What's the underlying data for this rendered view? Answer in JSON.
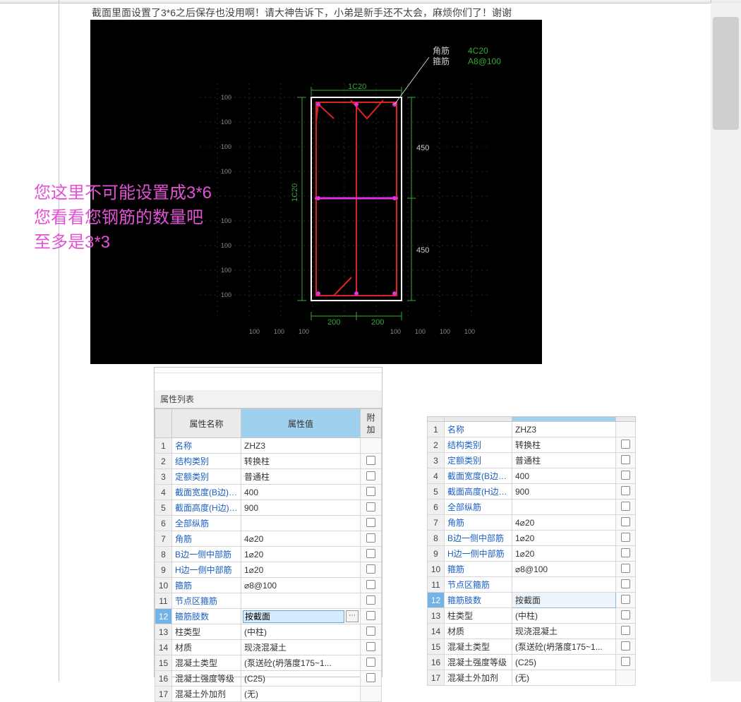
{
  "question_text": "截面里面设置了3*6之后保存也没用啊！请大神告诉下，小弟是新手还不太会，麻烦你们了！谢谢",
  "comment_lines": [
    "您这里不可能设置成3*6",
    "您看看您钢筋的数量吧",
    "至多是3*3"
  ],
  "cad": {
    "label_corner_rebar": "角筋",
    "label_stirrup": "箍筋",
    "val_corner_rebar": "4C20",
    "val_stirrup": "A8@100",
    "top_label": "1C20",
    "left_label": "1C20",
    "dim_right_upper": "450",
    "dim_right_lower": "450",
    "dim_bottom_left": "200",
    "dim_bottom_right": "200",
    "grid_minor": [
      "100",
      "100",
      "100",
      "100",
      "100",
      "100",
      "100"
    ],
    "grid_left_labels": [
      "100",
      "100",
      "100",
      "100",
      "100",
      "100",
      "100"
    ],
    "grid_bottom_labels": [
      "100",
      "100",
      "100",
      "100",
      "100",
      "100",
      "100"
    ]
  },
  "panel_left": {
    "title": "属性列表",
    "headers": {
      "name": "属性名称",
      "value": "属性值",
      "extra": "附加"
    },
    "rows": [
      {
        "n": 1,
        "name": "名称",
        "val": "ZHZ3",
        "chk": false,
        "link": true
      },
      {
        "n": 2,
        "name": "结构类别",
        "val": "转换柱",
        "chk": true,
        "link": true
      },
      {
        "n": 3,
        "name": "定额类别",
        "val": "普通柱",
        "chk": true,
        "link": true
      },
      {
        "n": 4,
        "name": "截面宽度(B边)(...",
        "val": "400",
        "chk": true,
        "link": true
      },
      {
        "n": 5,
        "name": "截面高度(H边)(...",
        "val": "900",
        "chk": true,
        "link": true
      },
      {
        "n": 6,
        "name": "全部纵筋",
        "val": "",
        "chk": true,
        "link": true
      },
      {
        "n": 7,
        "name": "角筋",
        "val": "4⌀20",
        "chk": true,
        "link": true
      },
      {
        "n": 8,
        "name": "B边一侧中部筋",
        "val": "1⌀20",
        "chk": true,
        "link": true
      },
      {
        "n": 9,
        "name": "H边一侧中部筋",
        "val": "1⌀20",
        "chk": true,
        "link": true
      },
      {
        "n": 10,
        "name": "箍筋",
        "val": "⌀8@100",
        "chk": true,
        "link": true
      },
      {
        "n": 11,
        "name": "节点区箍筋",
        "val": "",
        "chk": true,
        "link": true
      },
      {
        "n": 12,
        "name": "箍筋肢数",
        "val": "按截面",
        "chk": true,
        "link": true,
        "selected": true
      },
      {
        "n": 13,
        "name": "柱类型",
        "val": "(中柱)",
        "chk": true,
        "link": false
      },
      {
        "n": 14,
        "name": "材质",
        "val": "现浇混凝土",
        "chk": true,
        "link": false
      },
      {
        "n": 15,
        "name": "混凝土类型",
        "val": "(泵送砼(坍落度175~1...",
        "chk": true,
        "link": false
      },
      {
        "n": 16,
        "name": "混凝土强度等级",
        "val": "(C25)",
        "chk": true,
        "link": false
      },
      {
        "n": 17,
        "name": "混凝土外加剂",
        "val": "(无)",
        "chk": false,
        "link": false
      }
    ]
  },
  "panel_right": {
    "rows": [
      {
        "n": 1,
        "name": "名称",
        "val": "ZHZ3",
        "chk": false,
        "link": true
      },
      {
        "n": 2,
        "name": "结构类别",
        "val": "转换柱",
        "chk": true,
        "link": true
      },
      {
        "n": 3,
        "name": "定额类别",
        "val": "普通柱",
        "chk": true,
        "link": true
      },
      {
        "n": 4,
        "name": "截面宽度(B边)(...",
        "val": "400",
        "chk": true,
        "link": true
      },
      {
        "n": 5,
        "name": "截面高度(H边)(...",
        "val": "900",
        "chk": true,
        "link": true
      },
      {
        "n": 6,
        "name": "全部纵筋",
        "val": "",
        "chk": true,
        "link": true
      },
      {
        "n": 7,
        "name": "角筋",
        "val": "4⌀20",
        "chk": true,
        "link": true
      },
      {
        "n": 8,
        "name": "B边一侧中部筋",
        "val": "1⌀20",
        "chk": true,
        "link": true
      },
      {
        "n": 9,
        "name": "H边一侧中部筋",
        "val": "1⌀20",
        "chk": true,
        "link": true
      },
      {
        "n": 10,
        "name": "箍筋",
        "val": "⌀8@100",
        "chk": true,
        "link": true
      },
      {
        "n": 11,
        "name": "节点区箍筋",
        "val": "",
        "chk": true,
        "link": true
      },
      {
        "n": 12,
        "name": "箍筋肢数",
        "val": "按截面",
        "chk": true,
        "link": true,
        "selected": true
      },
      {
        "n": 13,
        "name": "柱类型",
        "val": "(中柱)",
        "chk": true,
        "link": false
      },
      {
        "n": 14,
        "name": "材质",
        "val": "现浇混凝土",
        "chk": true,
        "link": false
      },
      {
        "n": 15,
        "name": "混凝土类型",
        "val": "(泵送砼(坍落度175~1...",
        "chk": true,
        "link": false
      },
      {
        "n": 16,
        "name": "混凝土强度等级",
        "val": "(C25)",
        "chk": true,
        "link": false
      },
      {
        "n": 17,
        "name": "混凝土外加剂",
        "val": "(无)",
        "chk": false,
        "link": false
      }
    ]
  }
}
